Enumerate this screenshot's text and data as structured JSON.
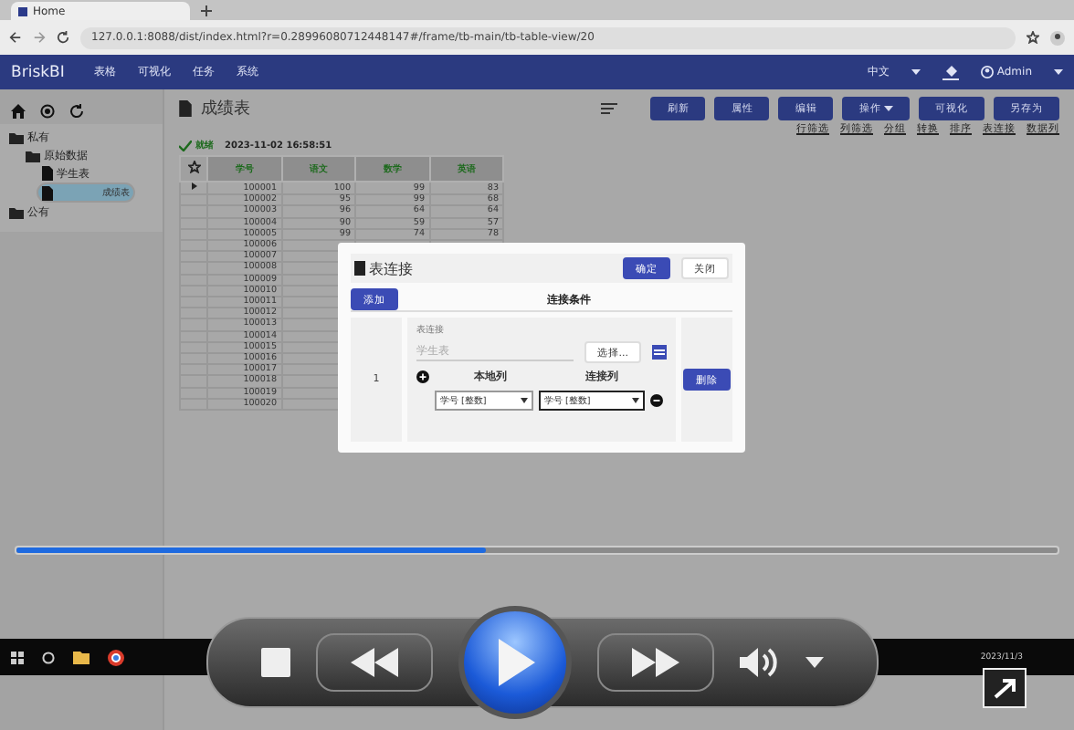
{
  "browser": {
    "tab_title": "Home",
    "url": "127.0.0.1:8088/dist/index.html?r=0.28996080712448147#/frame/tb-main/tb-table-view/20"
  },
  "app": {
    "brand": "BriskBI",
    "menu": [
      "表格",
      "可视化",
      "任务",
      "系统"
    ],
    "language": "中文",
    "user": "Admin"
  },
  "sidebar": {
    "tree": [
      {
        "label": "私有",
        "kind": "folder",
        "selected": false,
        "children": [
          {
            "label": "原始数据",
            "kind": "folder",
            "selected": false,
            "children": [
              {
                "label": "学生表",
                "kind": "file",
                "selected": false
              },
              {
                "label": "成绩表",
                "kind": "file",
                "selected": true
              }
            ]
          }
        ]
      },
      {
        "label": "公有",
        "kind": "folder",
        "selected": false
      }
    ]
  },
  "page": {
    "title": "成绩表",
    "buttons": [
      {
        "label": "刷新",
        "dropdown": false
      },
      {
        "label": "属性",
        "dropdown": false
      },
      {
        "label": "编辑",
        "dropdown": false
      },
      {
        "label": "操作",
        "dropdown": true
      },
      {
        "label": "可视化",
        "dropdown": false
      },
      {
        "label": "另存为",
        "dropdown": false
      }
    ],
    "links": [
      "行筛选",
      "列筛选",
      "分组",
      "转换",
      "排序",
      "表连接",
      "数据列"
    ],
    "status": {
      "label": "就绪",
      "time": "2023-11-02 16:58:51"
    }
  },
  "table": {
    "columns": [
      "学号",
      "语文",
      "数学",
      "英语"
    ],
    "rows": [
      [
        "100001",
        "100",
        "99",
        "83"
      ],
      [
        "100002",
        "95",
        "99",
        "68"
      ],
      [
        "100003",
        "96",
        "64",
        "64"
      ],
      [
        "100004",
        "90",
        "59",
        "57"
      ],
      [
        "100005",
        "99",
        "74",
        "78"
      ],
      [
        "100006"
      ],
      [
        "100007"
      ],
      [
        "100008"
      ],
      [
        "100009"
      ],
      [
        "100010"
      ],
      [
        "100011"
      ],
      [
        "100012"
      ],
      [
        "100013"
      ],
      [
        "100014"
      ],
      [
        "100015"
      ],
      [
        "100016"
      ],
      [
        "100017"
      ],
      [
        "100018"
      ],
      [
        "100019"
      ],
      [
        "100020"
      ]
    ]
  },
  "dialog": {
    "title": "表连接",
    "confirm": "确定",
    "close": "关闭",
    "add": "添加",
    "header": "连接条件",
    "rows": [
      {
        "index": "1",
        "table_label": "表连接",
        "table_value": "学生表",
        "choose": "选择...",
        "local_header": "本地列",
        "join_header": "连接列",
        "local_column": "学号 [整数]",
        "join_column": "学号 [整数]",
        "delete": "删除"
      }
    ]
  },
  "player": {
    "progress": {
      "level": 0.45
    }
  },
  "taskbar": {
    "date": "2023/11/3"
  }
}
